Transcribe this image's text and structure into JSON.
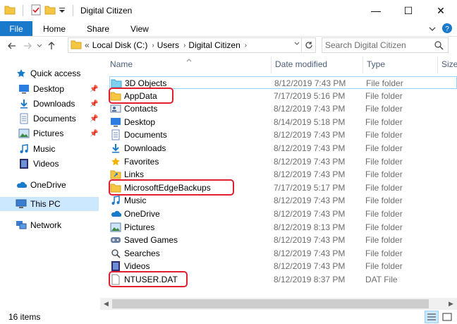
{
  "window": {
    "title": "Digital Citizen",
    "minimize_glyph": "—",
    "maximize_glyph": "☐",
    "close_glyph": "✕"
  },
  "ribbon": {
    "file": "File",
    "tabs": [
      "Home",
      "Share",
      "View"
    ]
  },
  "address": {
    "prefix": "«",
    "crumbs": [
      "Local Disk (C:)",
      "Users",
      "Digital Citizen"
    ],
    "separator": "›"
  },
  "search": {
    "placeholder": "Search Digital Citizen"
  },
  "nav": {
    "items": [
      {
        "label": "Quick access",
        "icon": "star-icon"
      },
      {
        "label": "Desktop",
        "icon": "desktop-icon",
        "pinned": true
      },
      {
        "label": "Downloads",
        "icon": "download-icon",
        "pinned": true
      },
      {
        "label": "Documents",
        "icon": "documents-icon",
        "pinned": true
      },
      {
        "label": "Pictures",
        "icon": "pictures-icon",
        "pinned": true
      },
      {
        "label": "Music",
        "icon": "music-icon"
      },
      {
        "label": "Videos",
        "icon": "videos-icon"
      },
      {
        "label": "OneDrive",
        "icon": "onedrive-icon"
      },
      {
        "label": "This PC",
        "icon": "computer-icon",
        "selected": true
      },
      {
        "label": "Network",
        "icon": "network-icon"
      }
    ]
  },
  "columns": {
    "name": "Name",
    "date": "Date modified",
    "type": "Type",
    "size": "Size"
  },
  "files": [
    {
      "name": "3D Objects",
      "date": "8/12/2019 7:43 PM",
      "type": "File folder",
      "icon": "3d-objects-icon"
    },
    {
      "name": "AppData",
      "date": "7/17/2019 5:16 PM",
      "type": "File folder",
      "icon": "folder-icon",
      "highlighted": true
    },
    {
      "name": "Contacts",
      "date": "8/12/2019 7:43 PM",
      "type": "File folder",
      "icon": "contacts-icon"
    },
    {
      "name": "Desktop",
      "date": "8/14/2019 5:18 PM",
      "type": "File folder",
      "icon": "desktop-icon"
    },
    {
      "name": "Documents",
      "date": "8/12/2019 7:43 PM",
      "type": "File folder",
      "icon": "documents-icon"
    },
    {
      "name": "Downloads",
      "date": "8/12/2019 7:43 PM",
      "type": "File folder",
      "icon": "download-icon"
    },
    {
      "name": "Favorites",
      "date": "8/12/2019 7:43 PM",
      "type": "File folder",
      "icon": "favorites-icon"
    },
    {
      "name": "Links",
      "date": "8/12/2019 7:43 PM",
      "type": "File folder",
      "icon": "links-icon"
    },
    {
      "name": "MicrosoftEdgeBackups",
      "date": "7/17/2019 5:17 PM",
      "type": "File folder",
      "icon": "folder-icon",
      "highlighted": true
    },
    {
      "name": "Music",
      "date": "8/12/2019 7:43 PM",
      "type": "File folder",
      "icon": "music-icon"
    },
    {
      "name": "OneDrive",
      "date": "8/12/2019 7:43 PM",
      "type": "File folder",
      "icon": "onedrive-icon"
    },
    {
      "name": "Pictures",
      "date": "8/12/2019 8:13 PM",
      "type": "File folder",
      "icon": "pictures-icon"
    },
    {
      "name": "Saved Games",
      "date": "8/12/2019 7:43 PM",
      "type": "File folder",
      "icon": "saved-games-icon"
    },
    {
      "name": "Searches",
      "date": "8/12/2019 7:43 PM",
      "type": "File folder",
      "icon": "searches-icon"
    },
    {
      "name": "Videos",
      "date": "8/12/2019 7:43 PM",
      "type": "File folder",
      "icon": "videos-icon"
    },
    {
      "name": "NTUSER.DAT",
      "date": "8/12/2019 8:37 PM",
      "type": "DAT File",
      "icon": "file-icon",
      "highlighted": true
    }
  ],
  "status": {
    "item_count": "16 items"
  },
  "colors": {
    "accent": "#1979ca",
    "selection": "#cce8ff",
    "highlight_border": "#e0202e",
    "folder": "#f5c544"
  }
}
